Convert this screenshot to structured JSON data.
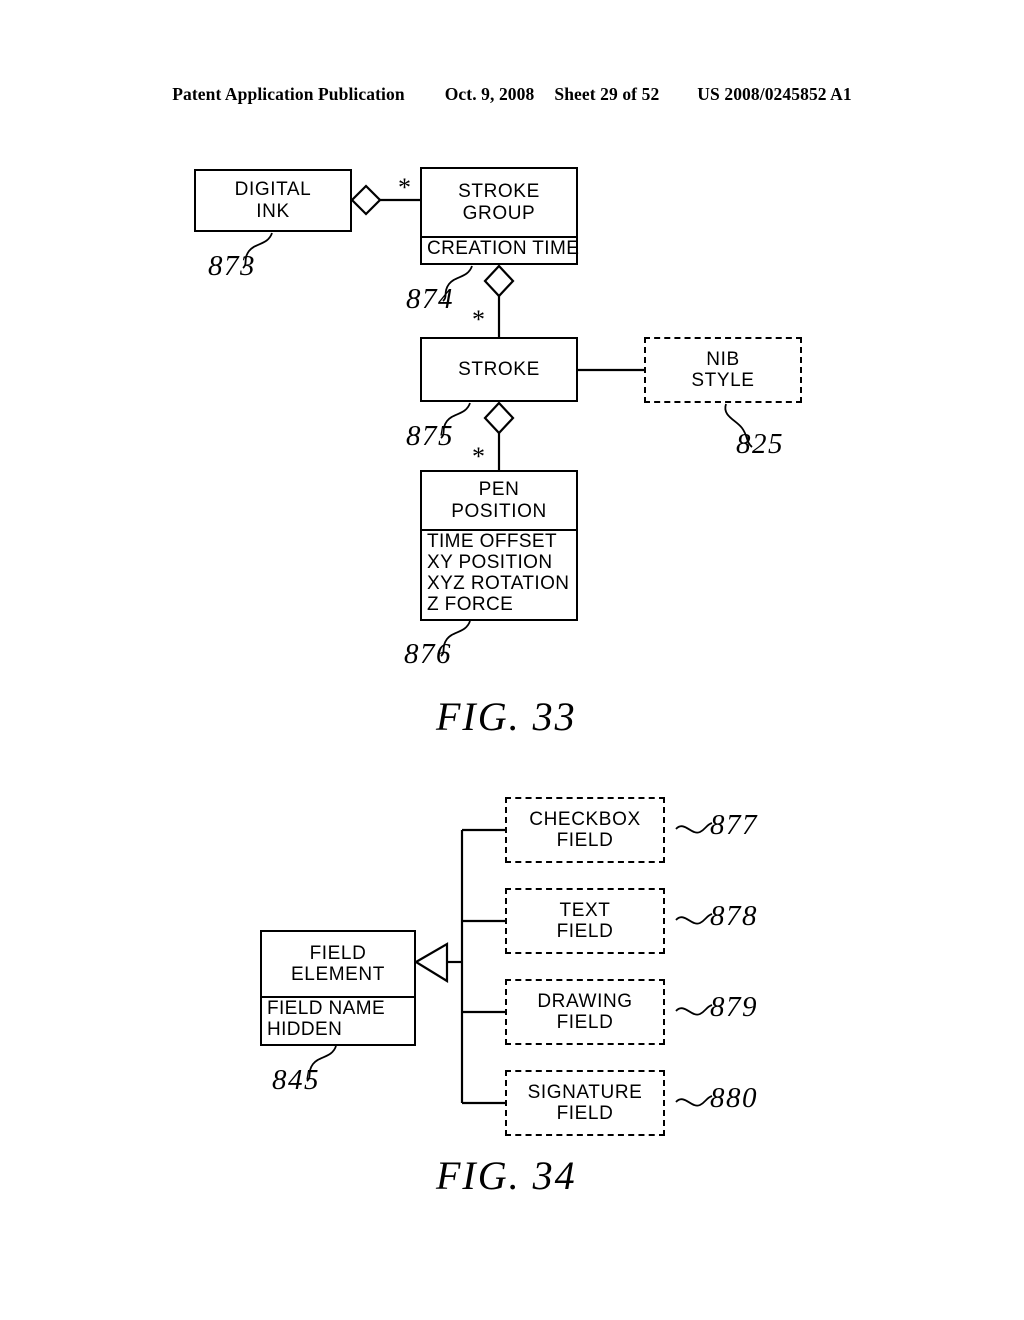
{
  "header": {
    "publication": "Patent Application Publication",
    "date": "Oct. 9, 2008",
    "sheet": "Sheet 29 of 52",
    "number": "US 2008/0245852 A1"
  },
  "figures": [
    {
      "caption": "FIG. 33",
      "nodes": [
        {
          "id": "digital-ink",
          "title": [
            "DIGITAL",
            "INK"
          ],
          "attributes": [],
          "ref": "873",
          "style": "solid"
        },
        {
          "id": "stroke-group",
          "title": [
            "STROKE",
            "GROUP"
          ],
          "attributes": [
            "CREATION TIME"
          ],
          "ref": "874",
          "style": "solid"
        },
        {
          "id": "stroke",
          "title": [
            "STROKE"
          ],
          "attributes": [],
          "ref": "875",
          "style": "solid"
        },
        {
          "id": "nib-style",
          "title": [
            "NIB",
            "STYLE"
          ],
          "attributes": [],
          "ref": "825",
          "style": "dashed"
        },
        {
          "id": "pen-position",
          "title": [
            "PEN",
            "POSITION"
          ],
          "attributes": [
            "TIME OFFSET",
            "XY POSITION",
            "XYZ ROTATION",
            "Z FORCE"
          ],
          "ref": "876",
          "style": "solid"
        }
      ],
      "multiplicities": [
        "*",
        "*",
        "*"
      ]
    },
    {
      "caption": "FIG. 34",
      "nodes": [
        {
          "id": "field-element",
          "title": [
            "FIELD",
            "ELEMENT"
          ],
          "attributes": [
            "FIELD NAME",
            "HIDDEN"
          ],
          "ref": "845",
          "style": "solid"
        },
        {
          "id": "checkbox-field",
          "title": [
            "CHECKBOX",
            "FIELD"
          ],
          "attributes": [],
          "ref": "877",
          "style": "dashed"
        },
        {
          "id": "text-field",
          "title": [
            "TEXT",
            "FIELD"
          ],
          "attributes": [],
          "ref": "878",
          "style": "dashed"
        },
        {
          "id": "drawing-field",
          "title": [
            "DRAWING",
            "FIELD"
          ],
          "attributes": [],
          "ref": "879",
          "style": "dashed"
        },
        {
          "id": "signature-field",
          "title": [
            "SIGNATURE",
            "FIELD"
          ],
          "attributes": [],
          "ref": "880",
          "style": "dashed"
        }
      ],
      "multiplicities": []
    }
  ],
  "colors": {
    "ink": "#000000",
    "paper": "#ffffff"
  }
}
